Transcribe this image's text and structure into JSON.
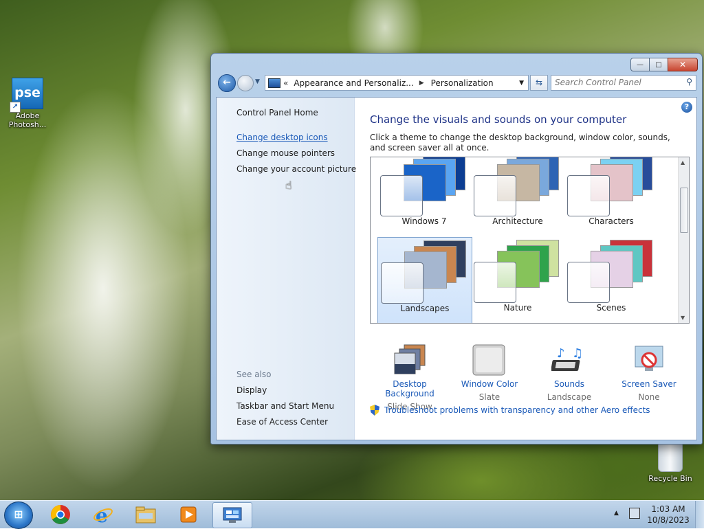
{
  "desktop": {
    "icons": [
      {
        "label": "Adobe Photosh...",
        "badge": "pse"
      },
      {
        "label": "Recycle Bin"
      }
    ]
  },
  "window": {
    "controls": {
      "minimize": "—",
      "maximize": "□",
      "close": "✕"
    },
    "address": {
      "chevron": "«",
      "crumbs": [
        "Appearance and Personaliz...",
        "Personalization"
      ]
    },
    "search": {
      "placeholder": "Search Control Panel"
    },
    "left_pane": {
      "home": "Control Panel Home",
      "links": [
        "Change desktop icons",
        "Change mouse pointers",
        "Change your account picture"
      ],
      "see_also_label": "See also",
      "see_also": [
        "Display",
        "Taskbar and Start Menu",
        "Ease of Access Center"
      ]
    },
    "main": {
      "title": "Change the visuals and sounds on your computer",
      "description": "Click a theme to change the desktop background, window color, sounds, and screen saver all at once.",
      "themes": [
        {
          "name": "Windows 7",
          "selected": false,
          "colors": [
            "#1a64c8",
            "#5aa5f2",
            "#0c3d92"
          ]
        },
        {
          "name": "Architecture",
          "selected": false,
          "colors": [
            "#c6b7a3",
            "#7aa8dc",
            "#2e64b4"
          ]
        },
        {
          "name": "Characters",
          "selected": false,
          "colors": [
            "#e4c3c9",
            "#7bd1f2",
            "#284d9a"
          ]
        },
        {
          "name": "Landscapes",
          "selected": true,
          "colors": [
            "#a5b6cf",
            "#c98650",
            "#2f3f5e"
          ]
        },
        {
          "name": "Nature",
          "selected": false,
          "colors": [
            "#86c35a",
            "#2fa34c",
            "#cfe2a0"
          ]
        },
        {
          "name": "Scenes",
          "selected": false,
          "colors": [
            "#e5d1e6",
            "#5fc7c3",
            "#c9323a"
          ]
        }
      ],
      "bottom": [
        {
          "name": "Desktop Background",
          "value": "Slide Show",
          "icon": "desktop-background-icon"
        },
        {
          "name": "Window Color",
          "value": "Slate",
          "icon": "window-color-icon"
        },
        {
          "name": "Sounds",
          "value": "Landscape",
          "icon": "sounds-icon"
        },
        {
          "name": "Screen Saver",
          "value": "None",
          "icon": "screen-saver-icon"
        }
      ],
      "troubleshoot": "Troubleshoot problems with transparency and other Aero effects"
    }
  },
  "taskbar": {
    "apps": [
      "chrome-icon",
      "internet-explorer-icon",
      "file-explorer-icon",
      "media-player-icon",
      "control-panel-icon"
    ],
    "clock": {
      "time": "1:03 AM",
      "date": "10/8/2023"
    }
  },
  "colors": {
    "link": "#1b5ab8",
    "heading": "#1e3287",
    "selection": "#cfe3fb"
  }
}
